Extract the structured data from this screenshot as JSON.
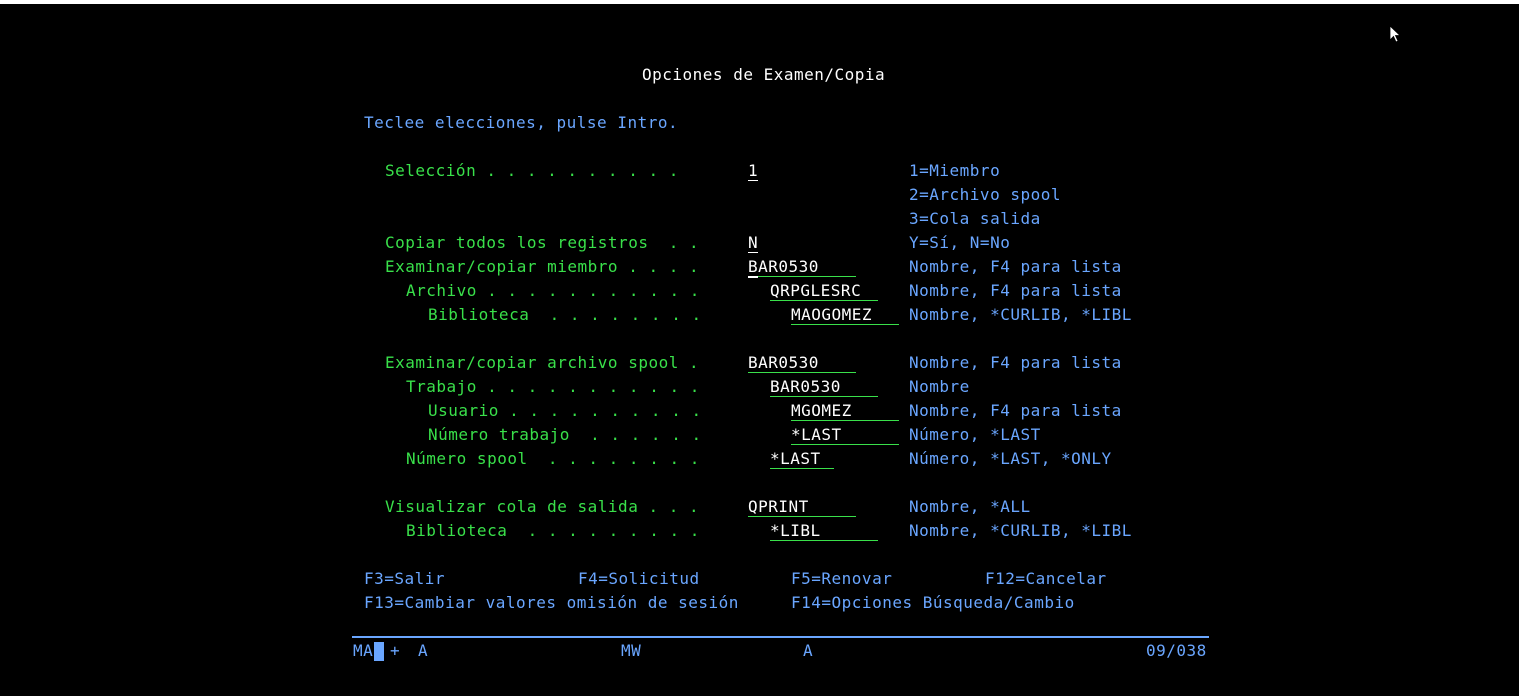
{
  "title": "Opciones de Examen/Copia",
  "instruction": "Teclee elecciones, pulse Intro.",
  "fields": [
    {
      "label": "Selección . . . . . . . . . .",
      "value": "1",
      "help": "1=Miembro"
    },
    {
      "help2": "2=Archivo spool"
    },
    {
      "help3": "3=Cola salida"
    },
    {
      "label": "Copiar todos los registros  . .",
      "value": "N",
      "help": "Y=Sí, N=No"
    },
    {
      "label": "Examinar/copiar miembro . . . .",
      "value": "BAR0530",
      "help": "Nombre, F4 para lista"
    },
    {
      "label": "Archivo . . . . . . . . . . .",
      "value": "QRPGLESRC",
      "help": "Nombre, F4 para lista"
    },
    {
      "label": "Biblioteca  . . . . . . . .",
      "value": "MAOGOMEZ",
      "help": "Nombre, *CURLIB, *LIBL"
    },
    {
      "label": "Examinar/copiar archivo spool .",
      "value": "BAR0530",
      "help": "Nombre, F4 para lista"
    },
    {
      "label": "Trabajo . . . . . . . . . . .",
      "value": "BAR0530",
      "help": "Nombre"
    },
    {
      "label": "Usuario . . . . . . . . . .",
      "value": "MGOMEZ",
      "help": "Nombre, F4 para lista"
    },
    {
      "label": "Número trabajo  . . . . . .",
      "value": "*LAST",
      "help": "Número, *LAST"
    },
    {
      "label": "Número spool  . . . . . . . .",
      "value": "*LAST",
      "help": "Número, *LAST, *ONLY"
    },
    {
      "label": "Visualizar cola de salida . . .",
      "value": "QPRINT",
      "help": "Nombre, *ALL"
    },
    {
      "label": "Biblioteca  . . . . . . . . .",
      "value": "*LIBL",
      "help": "Nombre, *CURLIB, *LIBL"
    }
  ],
  "fkeys": {
    "f3": "F3=Salir",
    "f4": "F4=Solicitud",
    "f5": "F5=Renovar",
    "f12": "F12=Cancelar",
    "f13": "F13=Cambiar valores omisión de sesión",
    "f14": "F14=Opciones Búsqueda/Cambio"
  },
  "status": {
    "left_a": "MA",
    "left_b": "+",
    "left_c": "A",
    "mid": "MW",
    "right_a": "A",
    "position": "09/038"
  },
  "colors": {
    "background": "#000000",
    "text": "#39e04a",
    "title": "#ffffff",
    "info": "#6aa6ff"
  }
}
